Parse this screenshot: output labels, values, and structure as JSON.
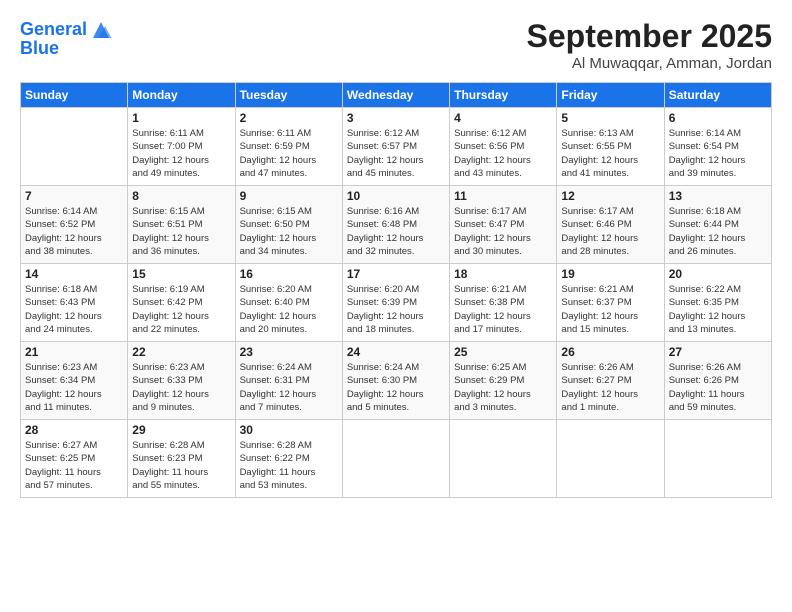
{
  "header": {
    "logo_line1": "General",
    "logo_line2": "Blue",
    "month": "September 2025",
    "location": "Al Muwaqqar, Amman, Jordan"
  },
  "weekdays": [
    "Sunday",
    "Monday",
    "Tuesday",
    "Wednesday",
    "Thursday",
    "Friday",
    "Saturday"
  ],
  "weeks": [
    [
      {
        "day": "",
        "info": ""
      },
      {
        "day": "1",
        "info": "Sunrise: 6:11 AM\nSunset: 7:00 PM\nDaylight: 12 hours\nand 49 minutes."
      },
      {
        "day": "2",
        "info": "Sunrise: 6:11 AM\nSunset: 6:59 PM\nDaylight: 12 hours\nand 47 minutes."
      },
      {
        "day": "3",
        "info": "Sunrise: 6:12 AM\nSunset: 6:57 PM\nDaylight: 12 hours\nand 45 minutes."
      },
      {
        "day": "4",
        "info": "Sunrise: 6:12 AM\nSunset: 6:56 PM\nDaylight: 12 hours\nand 43 minutes."
      },
      {
        "day": "5",
        "info": "Sunrise: 6:13 AM\nSunset: 6:55 PM\nDaylight: 12 hours\nand 41 minutes."
      },
      {
        "day": "6",
        "info": "Sunrise: 6:14 AM\nSunset: 6:54 PM\nDaylight: 12 hours\nand 39 minutes."
      }
    ],
    [
      {
        "day": "7",
        "info": "Sunrise: 6:14 AM\nSunset: 6:52 PM\nDaylight: 12 hours\nand 38 minutes."
      },
      {
        "day": "8",
        "info": "Sunrise: 6:15 AM\nSunset: 6:51 PM\nDaylight: 12 hours\nand 36 minutes."
      },
      {
        "day": "9",
        "info": "Sunrise: 6:15 AM\nSunset: 6:50 PM\nDaylight: 12 hours\nand 34 minutes."
      },
      {
        "day": "10",
        "info": "Sunrise: 6:16 AM\nSunset: 6:48 PM\nDaylight: 12 hours\nand 32 minutes."
      },
      {
        "day": "11",
        "info": "Sunrise: 6:17 AM\nSunset: 6:47 PM\nDaylight: 12 hours\nand 30 minutes."
      },
      {
        "day": "12",
        "info": "Sunrise: 6:17 AM\nSunset: 6:46 PM\nDaylight: 12 hours\nand 28 minutes."
      },
      {
        "day": "13",
        "info": "Sunrise: 6:18 AM\nSunset: 6:44 PM\nDaylight: 12 hours\nand 26 minutes."
      }
    ],
    [
      {
        "day": "14",
        "info": "Sunrise: 6:18 AM\nSunset: 6:43 PM\nDaylight: 12 hours\nand 24 minutes."
      },
      {
        "day": "15",
        "info": "Sunrise: 6:19 AM\nSunset: 6:42 PM\nDaylight: 12 hours\nand 22 minutes."
      },
      {
        "day": "16",
        "info": "Sunrise: 6:20 AM\nSunset: 6:40 PM\nDaylight: 12 hours\nand 20 minutes."
      },
      {
        "day": "17",
        "info": "Sunrise: 6:20 AM\nSunset: 6:39 PM\nDaylight: 12 hours\nand 18 minutes."
      },
      {
        "day": "18",
        "info": "Sunrise: 6:21 AM\nSunset: 6:38 PM\nDaylight: 12 hours\nand 17 minutes."
      },
      {
        "day": "19",
        "info": "Sunrise: 6:21 AM\nSunset: 6:37 PM\nDaylight: 12 hours\nand 15 minutes."
      },
      {
        "day": "20",
        "info": "Sunrise: 6:22 AM\nSunset: 6:35 PM\nDaylight: 12 hours\nand 13 minutes."
      }
    ],
    [
      {
        "day": "21",
        "info": "Sunrise: 6:23 AM\nSunset: 6:34 PM\nDaylight: 12 hours\nand 11 minutes."
      },
      {
        "day": "22",
        "info": "Sunrise: 6:23 AM\nSunset: 6:33 PM\nDaylight: 12 hours\nand 9 minutes."
      },
      {
        "day": "23",
        "info": "Sunrise: 6:24 AM\nSunset: 6:31 PM\nDaylight: 12 hours\nand 7 minutes."
      },
      {
        "day": "24",
        "info": "Sunrise: 6:24 AM\nSunset: 6:30 PM\nDaylight: 12 hours\nand 5 minutes."
      },
      {
        "day": "25",
        "info": "Sunrise: 6:25 AM\nSunset: 6:29 PM\nDaylight: 12 hours\nand 3 minutes."
      },
      {
        "day": "26",
        "info": "Sunrise: 6:26 AM\nSunset: 6:27 PM\nDaylight: 12 hours\nand 1 minute."
      },
      {
        "day": "27",
        "info": "Sunrise: 6:26 AM\nSunset: 6:26 PM\nDaylight: 11 hours\nand 59 minutes."
      }
    ],
    [
      {
        "day": "28",
        "info": "Sunrise: 6:27 AM\nSunset: 6:25 PM\nDaylight: 11 hours\nand 57 minutes."
      },
      {
        "day": "29",
        "info": "Sunrise: 6:28 AM\nSunset: 6:23 PM\nDaylight: 11 hours\nand 55 minutes."
      },
      {
        "day": "30",
        "info": "Sunrise: 6:28 AM\nSunset: 6:22 PM\nDaylight: 11 hours\nand 53 minutes."
      },
      {
        "day": "",
        "info": ""
      },
      {
        "day": "",
        "info": ""
      },
      {
        "day": "",
        "info": ""
      },
      {
        "day": "",
        "info": ""
      }
    ]
  ]
}
